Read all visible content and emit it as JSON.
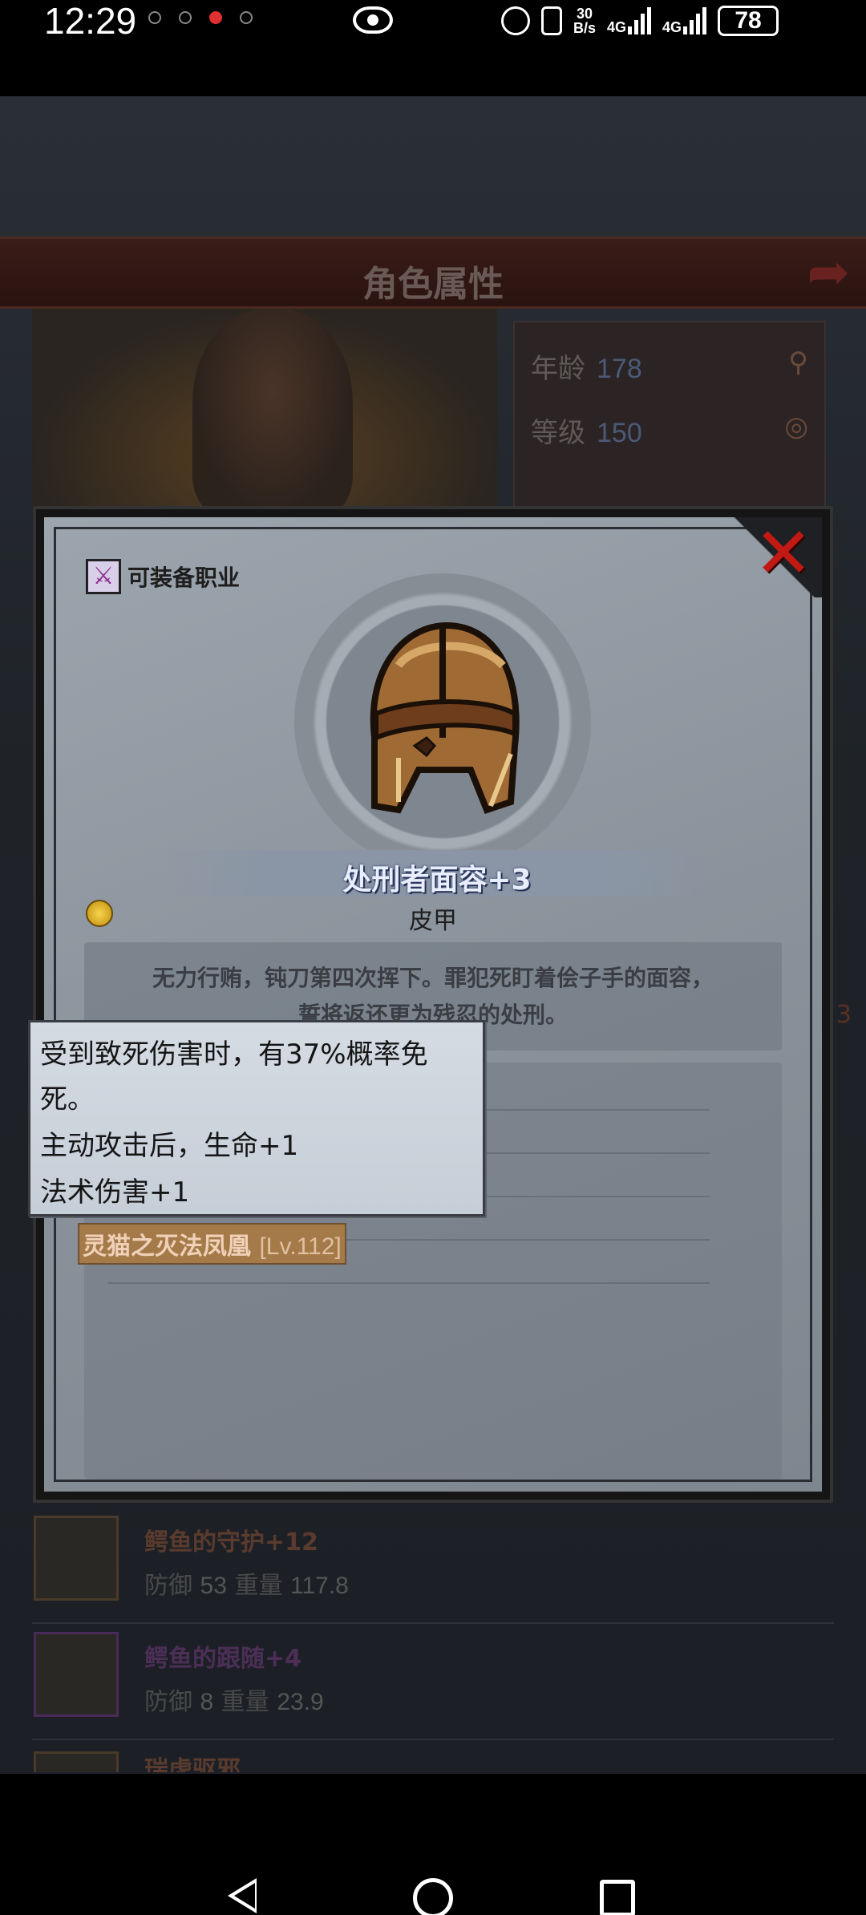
{
  "status_bar": {
    "time": "12:29",
    "net_speed_top": "30",
    "net_speed_bottom": "B/s",
    "net_type_1": "4G",
    "net_type_2": "4G",
    "battery": "78",
    "icons": [
      "notification-dot-icon",
      "notification-dot-icon",
      "notification-red-dot-icon",
      "notification-dot-icon",
      "eye-icon",
      "alarm-icon",
      "vibrate-icon",
      "signal-icon",
      "signal-icon",
      "battery-icon"
    ]
  },
  "background": {
    "title": "角色属性",
    "stats": {
      "age_label": "年龄",
      "age_value": "178",
      "level_label": "等级",
      "level_value": "150"
    },
    "side_number": "3",
    "equipment": [
      {
        "name": "鳄鱼的守护+12",
        "stat_text": "防御",
        "defense": "53",
        "weight_label": "重量",
        "weight": "117.8",
        "rarity": "brown"
      },
      {
        "name": "鳄鱼的跟随+4",
        "stat_text": "防御",
        "defense": "8",
        "weight_label": "重量",
        "weight": "23.9",
        "rarity": "purple"
      },
      {
        "name": "瑞虎驱邪",
        "stat_text": "",
        "defense": "",
        "weight_label": "",
        "weight": "",
        "rarity": "brown"
      }
    ]
  },
  "modal": {
    "class_label": "可装备职业",
    "item_name": "处刑者面容+3",
    "item_type": "皮甲",
    "description_line1": "无力行贿，钝刀第四次挥下。罪犯死盯着侩子手的面容，",
    "description_line2": "誓将返还更为残忍的处刑。",
    "set_name": "灵猫之灭法凤凰",
    "set_level": "[Lv.112]",
    "colors": {
      "close": "#c11a14",
      "item_name": "#e8eefc",
      "set_bg": "#a47a48"
    }
  },
  "tooltip": {
    "line1": "受到致死伤害时，有37%概率免",
    "line2": "死。",
    "line3": "主动攻击后，生命+1",
    "line4": "法术伤害+1"
  }
}
